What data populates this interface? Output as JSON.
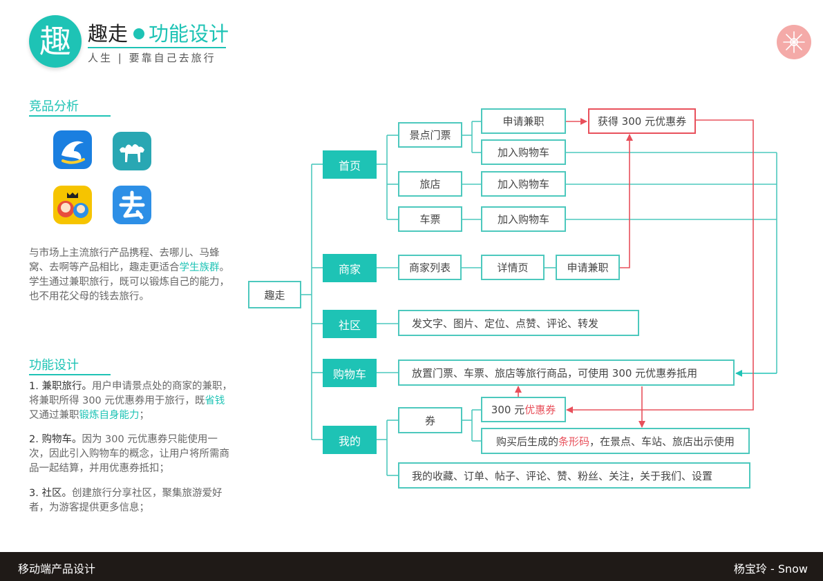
{
  "header": {
    "logo_char": "趣",
    "title": "趣走",
    "subtitle": "功能设计",
    "tagline": "人生 | 要靠自己去旅行"
  },
  "competition": {
    "title": "竞品分析",
    "apps": [
      {
        "name": "ctrip-app-icon",
        "color": "#1a7fe0"
      },
      {
        "name": "qunar-app-icon",
        "color": "#29a7b3"
      },
      {
        "name": "mafengwo-app-icon",
        "color": "#f6c400"
      },
      {
        "name": "quna-app-icon",
        "color": "#2d8fe6"
      }
    ],
    "para": {
      "part1": "与市场上主流旅行产品携程、去哪儿、马蜂窝、去啊等产品相比，趣走更适合",
      "highlight": "学生族群",
      "part2": "。学生通过兼职旅行，既可以锻炼自己的能力，也不用花父母的钱去旅行。"
    }
  },
  "features": {
    "title": "功能设计",
    "item1": {
      "head": "1. 兼职旅行。",
      "text1": "用户申请景点处的商家的兼职，将兼职所得 300 元优惠券用于旅行，既",
      "hl1": "省钱",
      "text2": "又通过兼职",
      "hl2": "锻炼自身能力",
      "text3": "；"
    },
    "item2": {
      "head": "2. 购物车。",
      "text": "因为 300 元优惠券只能使用一次，因此引入购物车的概念，让用户将所需商品一起结算，并用优惠券抵扣；"
    },
    "item3": {
      "head": "3. 社区。",
      "text": "创建旅行分享社区，聚集旅游爱好者，为游客提供更多信息；"
    }
  },
  "diagram": {
    "root": "趣走",
    "home": "首页",
    "merchant": "商家",
    "community": "社区",
    "cart": "购物车",
    "mine": "我的",
    "scenic_ticket": "景点门票",
    "apply_job_1": "申请兼职",
    "get_coupon": "获得 300 元优惠券",
    "add_cart_1": "加入购物车",
    "hotel": "旅店",
    "add_cart_2": "加入购物车",
    "train_ticket": "车票",
    "add_cart_3": "加入购物车",
    "merchant_list": "商家列表",
    "detail_page": "详情页",
    "apply_job_2": "申请兼职",
    "community_desc": "发文字、图片、定位、点赞、评论、转发",
    "cart_desc": "放置门票、车票、旅店等旅行商品，可使用 300 元优惠券抵用",
    "coupon": "券",
    "coupon_300_prefix": "300 元",
    "coupon_300_red": "优惠券",
    "barcode_prefix": "购买后生成的",
    "barcode_red": "条形码",
    "barcode_suffix": "，在景点、车站、旅店出示使用",
    "mine_desc": "我的收藏、订单、帖子、评论、赞、粉丝、关注，关于我们、设置"
  },
  "footer": {
    "left": "移动端产品设计",
    "right": "杨宝玲 - Snow"
  },
  "colors": {
    "accent": "#1ec3b5",
    "highlight_red": "#e8505b"
  }
}
